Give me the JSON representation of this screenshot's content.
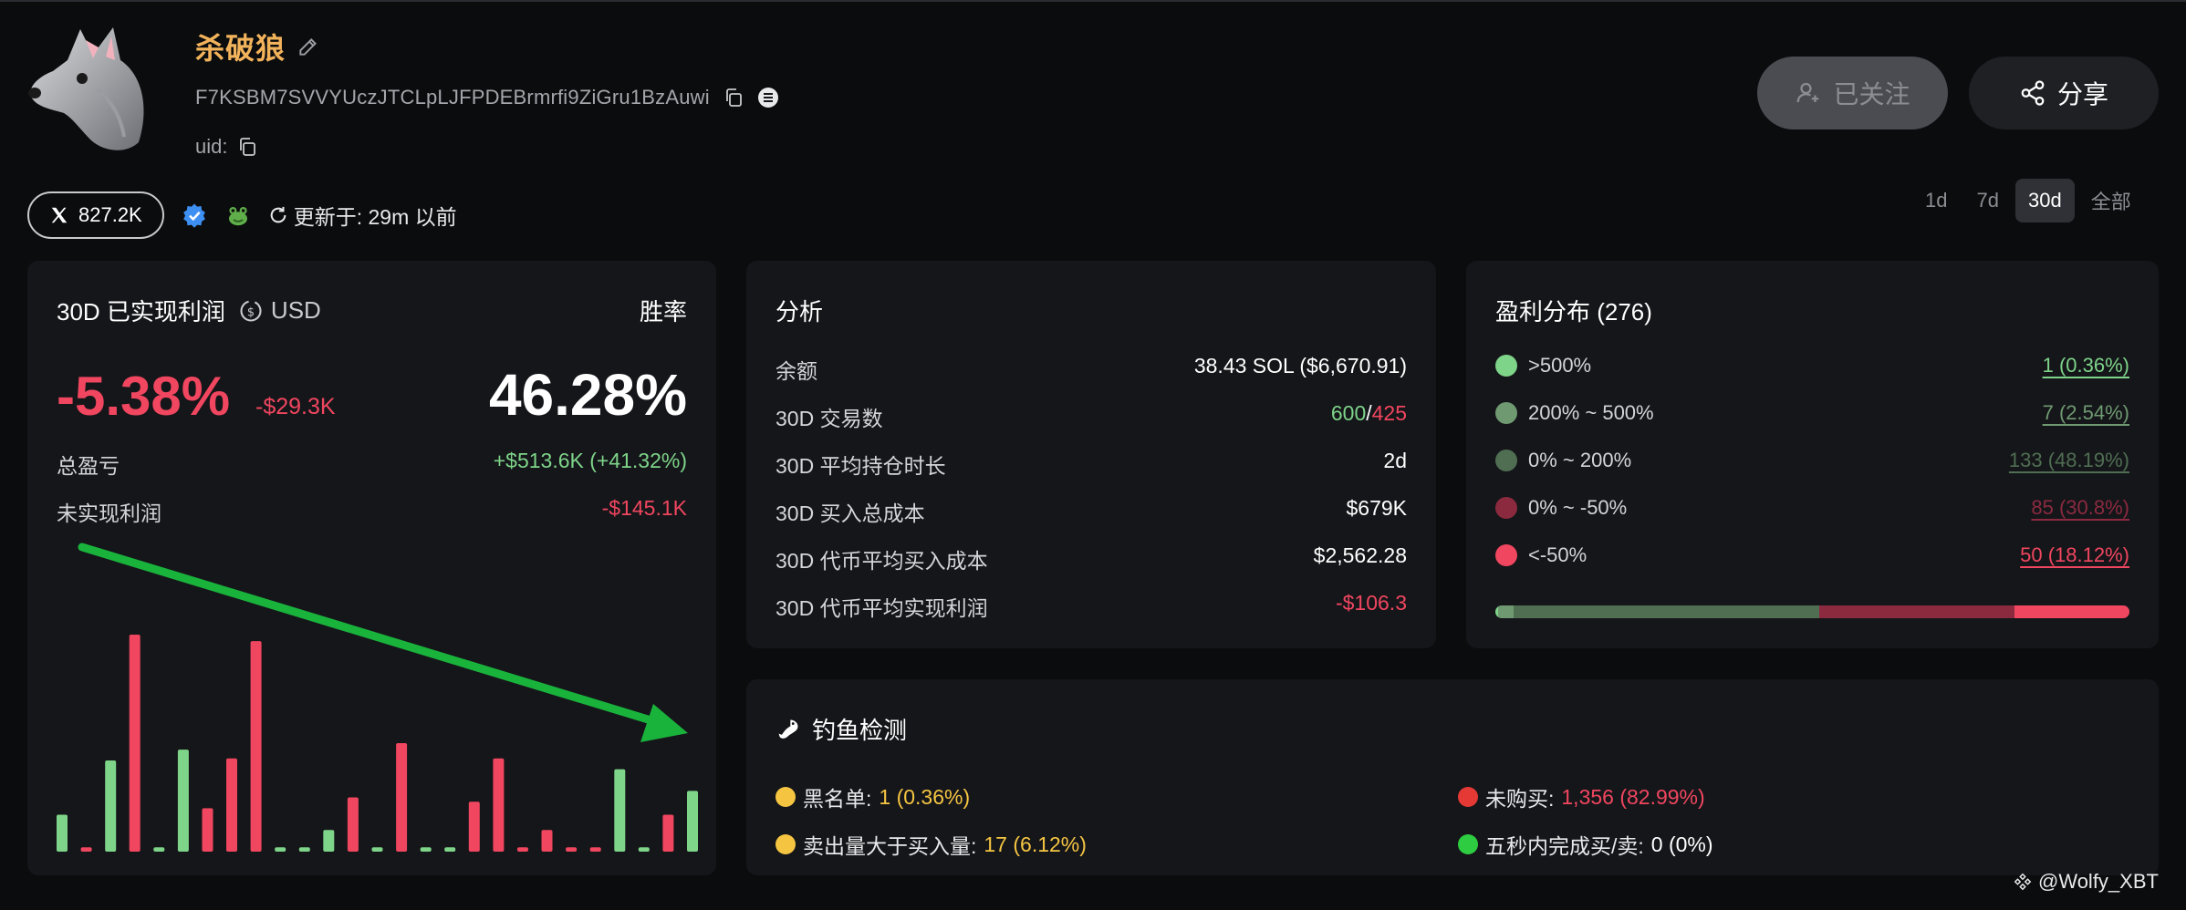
{
  "profile": {
    "name": "杀破狼",
    "address": "F7KSBM7SVVYUczJTCLpLJFPDEBrmrfi9ZiGru1BzAuwi",
    "uid_label": "uid:",
    "avatar_icon": "wolf-avatar-icon"
  },
  "actions": {
    "follow_label": "已关注",
    "share_label": "分享"
  },
  "meta": {
    "followers": "827.2K",
    "updated": "更新于: 29m 以前"
  },
  "tabs": [
    {
      "label": "1d",
      "active": false
    },
    {
      "label": "7d",
      "active": false
    },
    {
      "label": "30d",
      "active": true
    },
    {
      "label": "全部",
      "active": false
    }
  ],
  "profit": {
    "title": "30D 已实现利润",
    "currency": "USD",
    "winrate_label": "胜率",
    "pct": "-5.38%",
    "amount": "-$29.3K",
    "winrate": "46.28%",
    "total_label": "总盈亏",
    "total_value": "+$513.6K (+41.32%)",
    "unrealized_label": "未实现利润",
    "unrealized_value": "-$145.1K"
  },
  "chart_data": {
    "type": "bar",
    "values": [
      0.17,
      -0.02,
      0.42,
      -1.0,
      0.02,
      0.47,
      -0.2,
      -0.43,
      -0.97,
      0.02,
      0.02,
      0.1,
      -0.25,
      0.02,
      -0.5,
      0.02,
      0.02,
      -0.23,
      -0.43,
      -0.02,
      -0.1,
      -0.02,
      -0.02,
      0.38,
      0.02,
      -0.17,
      0.28
    ],
    "colors": {
      "positive": "#7ed489",
      "negative": "#f0465f"
    },
    "annotation": {
      "type": "arrow",
      "color": "#19b33c",
      "direction": "down-right"
    }
  },
  "analysis": {
    "title": "分析",
    "rows": [
      {
        "label": "余额",
        "value": "38.43 SOL ($6,670.91)"
      },
      {
        "label": "30D 交易数",
        "value_buy": "600",
        "sep": "/",
        "value_sell": "425"
      },
      {
        "label": "30D 平均持仓时长",
        "value": "2d"
      },
      {
        "label": "30D 买入总成本",
        "value": "$679K"
      },
      {
        "label": "30D 代币平均买入成本",
        "value": "$2,562.28"
      },
      {
        "label": "30D 代币平均实现利润",
        "value": "-$106.3"
      }
    ]
  },
  "distribution": {
    "title": "盈利分布 (276)",
    "rows": [
      {
        "label": ">500%",
        "value": "1 (0.36%)",
        "color": "#7ed489",
        "share": 0.0036
      },
      {
        "label": "200% ~ 500%",
        "value": "7 (2.54%)",
        "color": "#6f9a71",
        "share": 0.0254
      },
      {
        "label": "0% ~ 200%",
        "value": "133 (48.19%)",
        "color": "#4f6e52",
        "share": 0.4819
      },
      {
        "label": "0% ~ -50%",
        "value": "85 (30.8%)",
        "color": "#8b2a3f",
        "share": 0.308
      },
      {
        "label": "<-50%",
        "value": "50 (18.12%)",
        "color": "#f0465f",
        "share": 0.1812
      }
    ]
  },
  "phishing": {
    "title": "钓鱼检测",
    "items": [
      {
        "label": "黑名单:",
        "value": "1 (0.36%)",
        "color": "#f5c542",
        "value_color": "#f5c542"
      },
      {
        "label": "卖出量大于买入量:",
        "value": "17 (6.12%)",
        "color": "#f5c542",
        "value_color": "#f5c542"
      },
      {
        "label": "未购买:",
        "value": "1,356 (82.99%)",
        "color": "#e53935",
        "value_color": "#f0465f"
      },
      {
        "label": "五秒内完成买/卖:",
        "value": "0 (0%)",
        "color": "#2ecc40",
        "value_color": "#ffffff"
      }
    ]
  },
  "watermark": "@Wolfy_XBT"
}
